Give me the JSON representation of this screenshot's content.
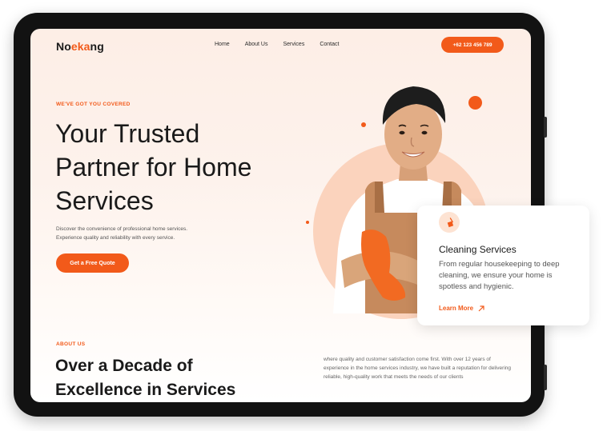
{
  "brand": {
    "logo_pre": "No",
    "logo_accent": "eka",
    "logo_post": "ng"
  },
  "nav": {
    "items": [
      "Home",
      "About Us",
      "Services",
      "Contact"
    ]
  },
  "header": {
    "phone_label": "+62 123 456 789"
  },
  "hero": {
    "eyebrow": "WE'VE GOT YOU COVERED",
    "title_line1": "Your Trusted",
    "title_line2": "Partner for Home",
    "title_line3": "Services",
    "desc_line1": "Discover the convenience of professional home services.",
    "desc_line2": "Experience quality and reliability with every service.",
    "cta_label": "Get a Free Quote"
  },
  "service_card": {
    "icon": "broom-icon",
    "title": "Cleaning Services",
    "text": "From regular housekeeping to deep cleaning, we ensure your home is spotless and hygienic.",
    "link_label": "Learn More",
    "link_icon": "arrow-up-right-icon"
  },
  "about": {
    "eyebrow": "ABOUT US",
    "title_line1": "Over a Decade of",
    "title_line2": "Excellence in Services",
    "text": "where quality and customer satisfaction come first. With over 12 years of experience in the home services industry, we have built a reputation for delivering reliable, high-quality work that meets the needs of our clients"
  },
  "colors": {
    "accent": "#f25a1a",
    "dark": "#1a1a1a",
    "hero_bg": "#fdeee6",
    "tablet": "#121212"
  }
}
